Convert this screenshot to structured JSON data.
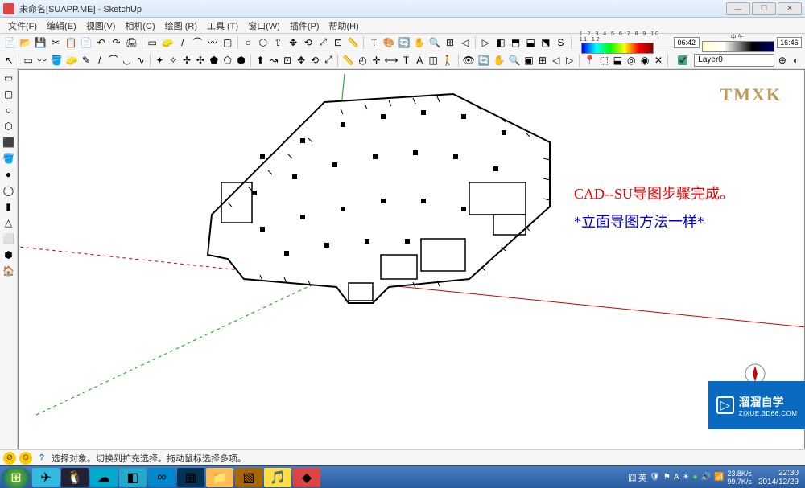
{
  "title": "未命名[SUAPP.ME] - SketchUp",
  "menus": [
    "文件(F)",
    "编辑(E)",
    "视图(V)",
    "相机(C)",
    "绘图 (R)",
    "工具 (T)",
    "窗口(W)",
    "插件(P)",
    "帮助(H)"
  ],
  "toolbar1_icons": [
    "file-new-icon",
    "file-open-icon",
    "save-icon",
    "cut-icon",
    "copy-icon",
    "paste-icon",
    "undo-icon",
    "redo-icon",
    "print-icon",
    "select-icon",
    "eraser-icon",
    "line-icon",
    "arc-icon",
    "freehand-icon",
    "rect-icon",
    "circle-icon",
    "polygon-icon",
    "pushpull-icon",
    "move-icon",
    "rotate-icon",
    "scale-icon",
    "offset-icon",
    "tape-icon",
    "text-icon",
    "paint-icon",
    "orbit-icon",
    "pan-icon",
    "zoom-icon",
    "zoom-extents-icon",
    "prev-view-icon",
    "next-view-icon",
    "iso-icon",
    "top-icon",
    "front-icon",
    "right-icon",
    "suapp-icon"
  ],
  "color_scale_labels": "1 2 3 4 5 6 7 8 9 10 11 12",
  "time1": "06:42",
  "time_mid": "中午",
  "time2": "16:46",
  "toolbar2_icons": [
    "pointer-icon",
    "rect-sel-icon",
    "lasso-icon",
    "paint-bucket-icon",
    "eraser2-icon",
    "pencil-icon",
    "line2-icon",
    "arc2-icon",
    "arc3-icon",
    "bezier-icon",
    "star-icon",
    "shape1-icon",
    "shape2-icon",
    "spiral-icon",
    "shape3-icon",
    "shape4-icon",
    "shape5-icon",
    "push-icon",
    "follow-icon",
    "offset2-icon",
    "move2-icon",
    "rotate2-icon",
    "scale2-icon",
    "tape2-icon",
    "protractor-icon",
    "axes-icon",
    "dimension-icon",
    "text2-icon",
    "3dtext-icon",
    "section-icon",
    "walk-icon",
    "look-icon",
    "orbit2-icon",
    "pan2-icon",
    "zoom2-icon",
    "zoom-win-icon",
    "zoom-ext-icon",
    "prev-icon",
    "next-icon",
    "position-icon",
    "sandbox1-icon",
    "sandbox2-icon",
    "solid1-icon",
    "solid2-icon",
    "solid3-icon"
  ],
  "layer_label": "Layer0",
  "left_icons": [
    "rect-tool-icon",
    "rrect-tool-icon",
    "circle-tool-icon",
    "polygon-tool-icon",
    "3dbox-icon",
    "bucket-icon",
    "sphere-icon",
    "torus-icon",
    "cylinder-icon",
    "cone-icon",
    "tube-icon",
    "prism-icon",
    "house-icon"
  ],
  "watermark": "TMXK",
  "annotation_red": "CAD--SU导图步骤完成。",
  "annotation_blue": "*立面导图方法一样*",
  "status_text": "选择对象。切换到扩充选择。拖动鼠标选择多项。",
  "tray": {
    "ime": "囧 英",
    "icons": [
      "shield-icon",
      "flag-icon",
      "a-icon",
      "sun-icon",
      "360-icon",
      "vol-icon",
      "net-icon"
    ],
    "speed1": "23.8K/s",
    "speed2": "99.7K/s",
    "time": "22:30",
    "date": "2014/12/29"
  },
  "brand": {
    "big": "溜溜自学",
    "small": "ZIXUE.3D66.COM"
  },
  "tool_glyphs": [
    "📄",
    "📂",
    "💾",
    "✂",
    "📋",
    "📄",
    "↶",
    "↷",
    "🖨",
    "▭",
    "🧽",
    "/",
    "⌒",
    "〰",
    "▢",
    "○",
    "⬡",
    "⇧",
    "✥",
    "⟲",
    "⤢",
    "⊡",
    "📏",
    "T",
    "🎨",
    "🔄",
    "✋",
    "🔍",
    "⊞",
    "◁",
    "▷",
    "◧",
    "⬒",
    "⬓",
    "⬔",
    "S"
  ],
  "tool2_glyphs": [
    "↖",
    "▭",
    "〰",
    "🪣",
    "🧽",
    "✎",
    "/",
    "⌒",
    "◡",
    "∿",
    "✦",
    "✧",
    "✢",
    "✣",
    "⬟",
    "⬠",
    "⬢",
    "⬆",
    "↝",
    "⊡",
    "✥",
    "⟲",
    "⤢",
    "📏",
    "◴",
    "✛",
    "⟷",
    "T",
    "A",
    "◫",
    "🚶",
    "👁",
    "🔄",
    "✋",
    "🔍",
    "▣",
    "⊞",
    "◁",
    "▷",
    "📍",
    "⬚",
    "⬓",
    "◎",
    "◉",
    "✕"
  ],
  "left_glyphs": [
    "▭",
    "▢",
    "○",
    "⬡",
    "⬛",
    "🪣",
    "●",
    "◯",
    "▮",
    "△",
    "⬜",
    "⬢",
    "🏠"
  ]
}
